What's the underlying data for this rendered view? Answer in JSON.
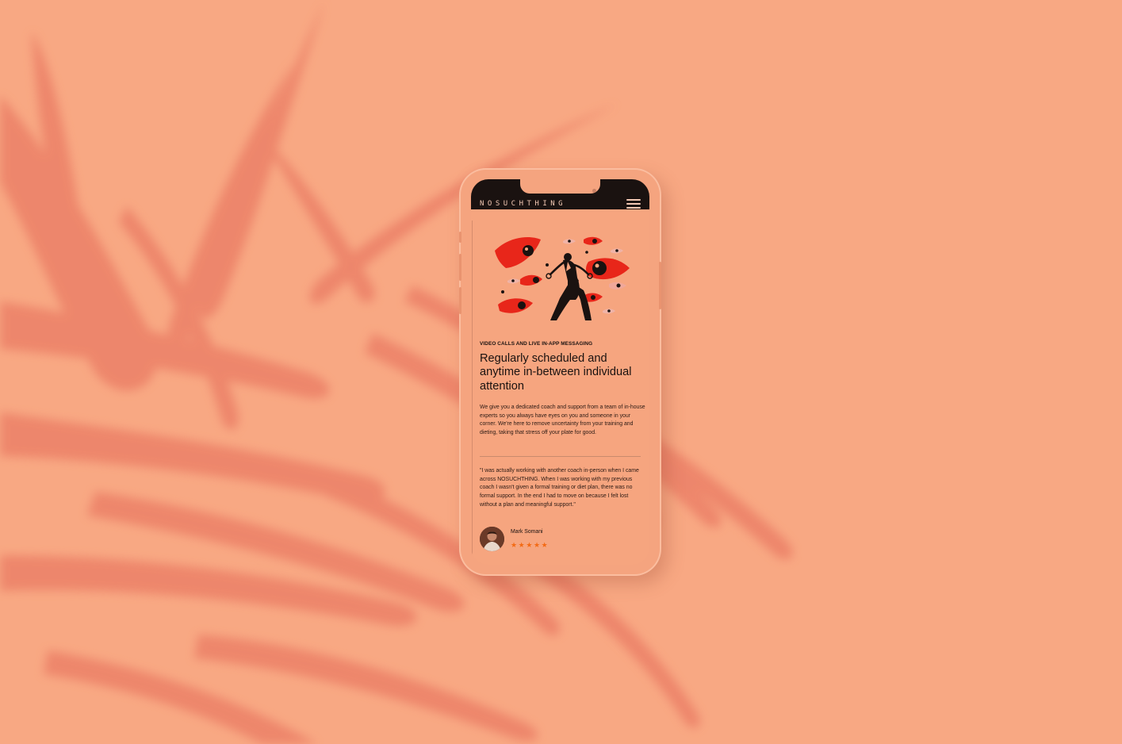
{
  "app": {
    "brand": "NOSUCHTHING"
  },
  "header": {
    "menu_icon": "hamburger-menu-icon"
  },
  "feature": {
    "eyebrow": "VIDEO CALLS AND LIVE IN-APP MESSAGING",
    "headline": "Regularly scheduled and anytime in-between individual attention",
    "body": "We give you a dedicated coach and support from a team of in-house experts so you always have eyes on you and someone in your corner. We're here to remove uncertainty from your training and dieting, taking that stress off your plate for good."
  },
  "testimonial": {
    "quote": "\"I was actually working with another coach in-person when I came across NOSUCHTHING. When I was working with my previous coach I wasn't given a formal training or diet plan, there was no formal support. In the end I had to move on because I felt lost without a plan and meaningful support.\"",
    "name": "Mark Somani",
    "rating": 5,
    "stars": "★★★★★"
  },
  "colors": {
    "background": "#f8a883",
    "plant_shadow": "#ec8168",
    "header_bar": "#1a1210",
    "eye_red": "#e8261a",
    "star": "#f36a14"
  }
}
